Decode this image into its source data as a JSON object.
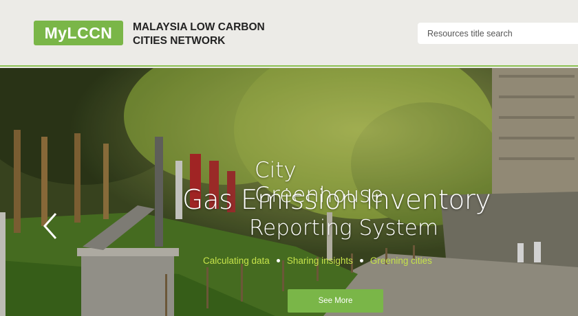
{
  "header": {
    "logo_text": "MyLCCN",
    "org_name_line1": "MALAYSIA LOW CARBON",
    "org_name_line2": "CITIES NETWORK",
    "search_placeholder": "Resources title search"
  },
  "hero": {
    "title_line1": "City Greenhouse",
    "title_line2": "Gas Emission Inventory",
    "title_line3": "Reporting System",
    "taglines": [
      "Calculating data",
      "Sharing insights",
      "Greening cities"
    ],
    "button_label": "See More",
    "prev_icon": "chevron-left-icon"
  },
  "colors": {
    "brand_green": "#7ab648",
    "tagline_green": "#c6e34a",
    "header_bg": "#ecebe7"
  }
}
